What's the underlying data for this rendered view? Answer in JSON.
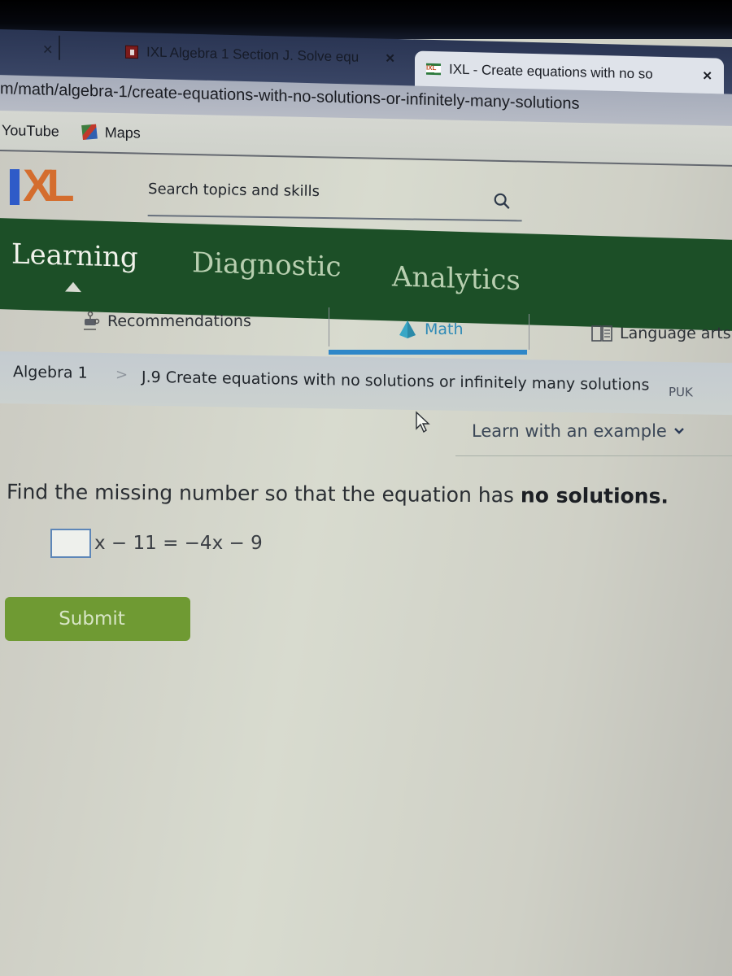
{
  "browser": {
    "tabs": [
      {
        "title": "IXL Algebra 1 Section J. Solve equ",
        "icon": "page-favicon",
        "active": false
      },
      {
        "title": "IXL - Create equations with no so",
        "icon": "ixl-favicon",
        "active": true
      }
    ],
    "address": "m/math/algebra-1/create-equations-with-no-solutions-or-infinitely-many-solutions",
    "bookmarks": [
      {
        "label": "YouTube",
        "icon": null
      },
      {
        "label": "Maps",
        "icon": "maps-icon"
      }
    ]
  },
  "header": {
    "logo": {
      "i": "I",
      "xl": "XL"
    },
    "search_placeholder": "Search topics and skills"
  },
  "nav": {
    "items": [
      {
        "label": "Learning",
        "active": true
      },
      {
        "label": "Diagnostic",
        "active": false
      },
      {
        "label": "Analytics",
        "active": false
      }
    ]
  },
  "subnav": {
    "items": [
      {
        "label": "Recommendations",
        "icon": "recommendations-icon",
        "active": false
      },
      {
        "label": "Math",
        "icon": "math-icon",
        "active": true
      },
      {
        "label": "Language arts",
        "icon": "book-icon",
        "active": false
      }
    ]
  },
  "breadcrumb": {
    "root": "Algebra 1",
    "separator": ">",
    "skill": "J.9 Create equations with no solutions or infinitely many solutions",
    "code": "PUK"
  },
  "learn_example": "Learn with an example",
  "question": {
    "prefix": "Find the missing number so that the equation has ",
    "emphasis": "no solutions.",
    "equation_rest": "x − 11 = −4x − 9",
    "answer_value": ""
  },
  "submit_label": "Submit",
  "colors": {
    "nav_green": "#1c4f27",
    "math_blue": "#2f87c8",
    "submit_green": "#6f9a33",
    "ixl_blue": "#2f5bc8",
    "ixl_orange": "#d46d2e"
  }
}
